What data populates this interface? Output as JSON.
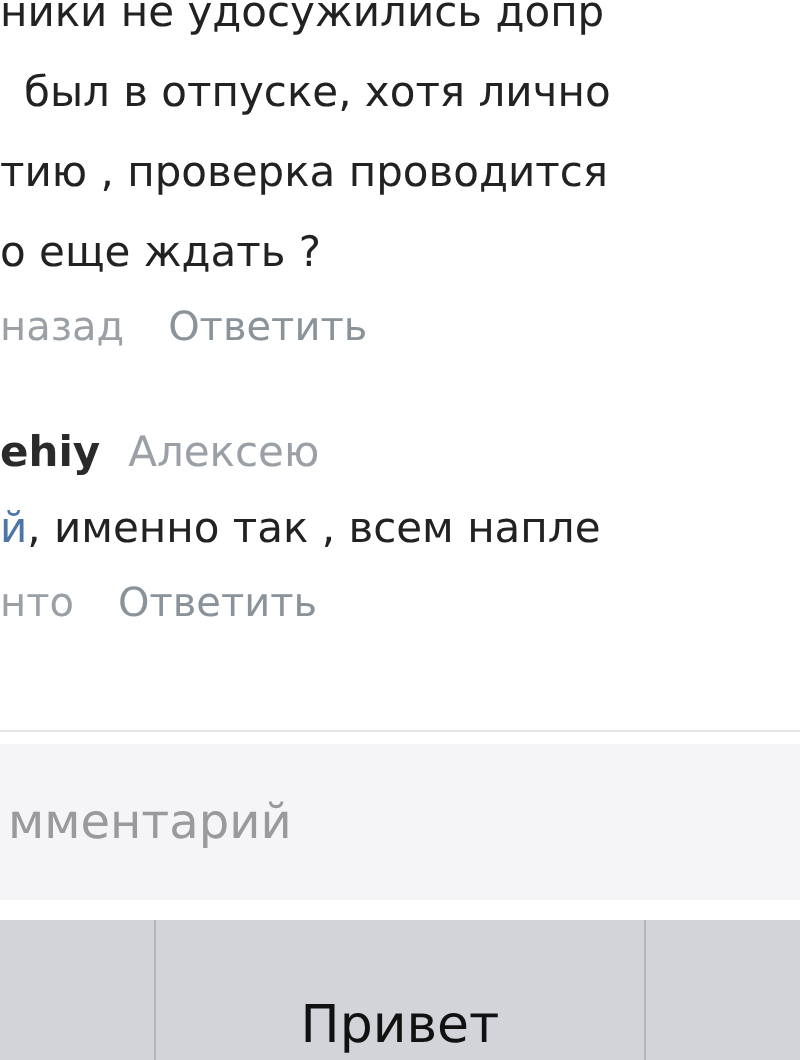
{
  "comments": [
    {
      "lines": [
        "ники не удосужились допр",
        "был в отпуске, хотя лично",
        "тию , проверка проводится",
        "о еще ждать ?"
      ],
      "time": "назад",
      "reply_action": "Ответить"
    },
    {
      "author": "ehiy",
      "addressee": "Алексею",
      "mention": "й",
      "lines": [
        ", именно так , всем напле"
      ],
      "time": "нто",
      "reply_action": "Ответить"
    }
  ],
  "comment_input": {
    "placeholder": "мментарий"
  },
  "keyboard_suggestion": {
    "label": "Привет"
  }
}
